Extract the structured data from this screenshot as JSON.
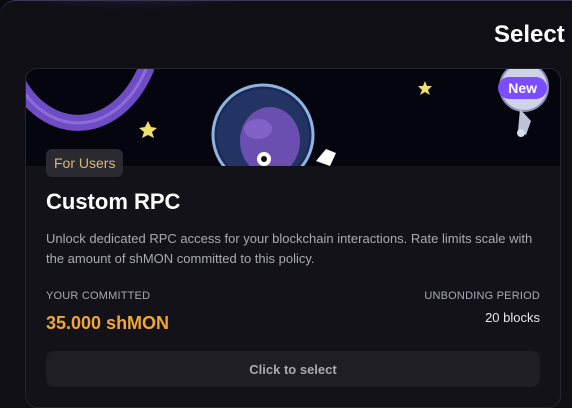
{
  "modal": {
    "title": "Select a"
  },
  "card": {
    "badge": "New",
    "tag": "For Users",
    "title": "Custom RPC",
    "description": "Unlock dedicated RPC access for your blockchain interactions. Rate limits scale with the amount of shMON committed to this policy.",
    "committed_label": "YOUR COMMITTED",
    "committed_value": "35.000 shMON",
    "unbonding_label": "UNBONDING PERIOD",
    "unbonding_value": "20 blocks",
    "button_label": "Click to select"
  },
  "colors": {
    "accent": "#7c4dff",
    "committed_value": "#f0a63a",
    "tag_text": "#d9b777",
    "star": "#f1e06b"
  },
  "icons": [
    "star-icon",
    "astronaut-illustration"
  ]
}
